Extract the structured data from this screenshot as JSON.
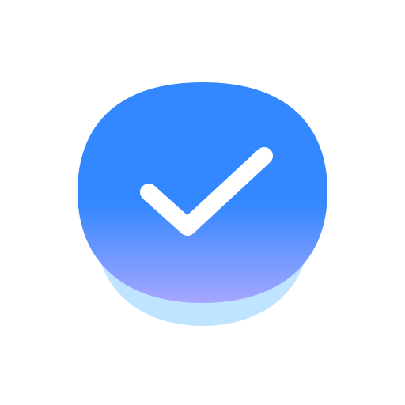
{
  "icon": {
    "name": "checkmark-icon",
    "colors": {
      "background": "#ffffff",
      "shadow": "#bfe4ff",
      "button_top": "#3388ff",
      "button_bottom": "#a7a6ff",
      "check": "#ffffff"
    }
  }
}
